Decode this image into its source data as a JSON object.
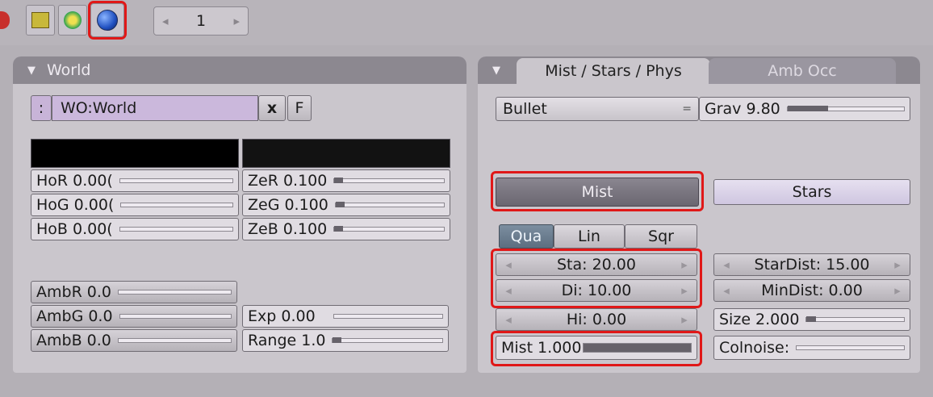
{
  "toolbar": {
    "icons": [
      "material-icon",
      "texture-icon",
      "radiosity-icon",
      "world-icon"
    ],
    "page_value": "1",
    "prev_arrow": "◂",
    "next_arrow": "▸"
  },
  "world_panel": {
    "title": "World",
    "browse_label": ":",
    "datablock_name": "WO:World",
    "delete_label": "x",
    "fake_user_label": "F",
    "horizon": [
      {
        "label": "HoR 0.00(",
        "value": 0.0
      },
      {
        "label": "HoG 0.00(",
        "value": 0.0
      },
      {
        "label": "HoB 0.00(",
        "value": 0.0
      }
    ],
    "zenith": [
      {
        "label": "ZeR 0.100",
        "value": 0.1
      },
      {
        "label": "ZeG 0.100",
        "value": 0.1
      },
      {
        "label": "ZeB 0.100",
        "value": 0.1
      }
    ],
    "ambient": [
      {
        "label": "AmbR 0.0",
        "value": 0.0
      },
      {
        "label": "AmbG 0.0",
        "value": 0.0
      },
      {
        "label": "AmbB 0.0",
        "value": 0.0
      }
    ],
    "exposure": {
      "label": "Exp 0.00",
      "value": 0.0
    },
    "range": {
      "label": "Range 1.0",
      "value": 0.1
    }
  },
  "mist_panel": {
    "tab_active": "Mist / Stars / Phys",
    "tab_inactive": "Amb Occ",
    "physics_engine": "Bullet",
    "physics_dropdown": "=",
    "gravity": {
      "label": "Grav 9.80",
      "value": 0.35
    },
    "mist_button": "Mist",
    "stars_button": "Stars",
    "falloff": [
      "Qua",
      "Lin",
      "Sqr"
    ],
    "falloff_selected": "Qua",
    "sta": "Sta: 20.00",
    "di": "Di: 10.00",
    "hi": "Hi: 0.00",
    "mist_intensity": {
      "label": "Mist 1.000",
      "value": 1.0
    },
    "stardist": "StarDist: 15.00",
    "mindist": "MinDist: 0.00",
    "size": {
      "label": "Size 2.000",
      "value": 0.1
    },
    "colnoise": {
      "label": "Colnoise:",
      "value": 0.0
    }
  },
  "colors": {
    "highlight": "#e01818",
    "panel_bg": "#cac6cc",
    "header_bg": "#8c8890"
  }
}
